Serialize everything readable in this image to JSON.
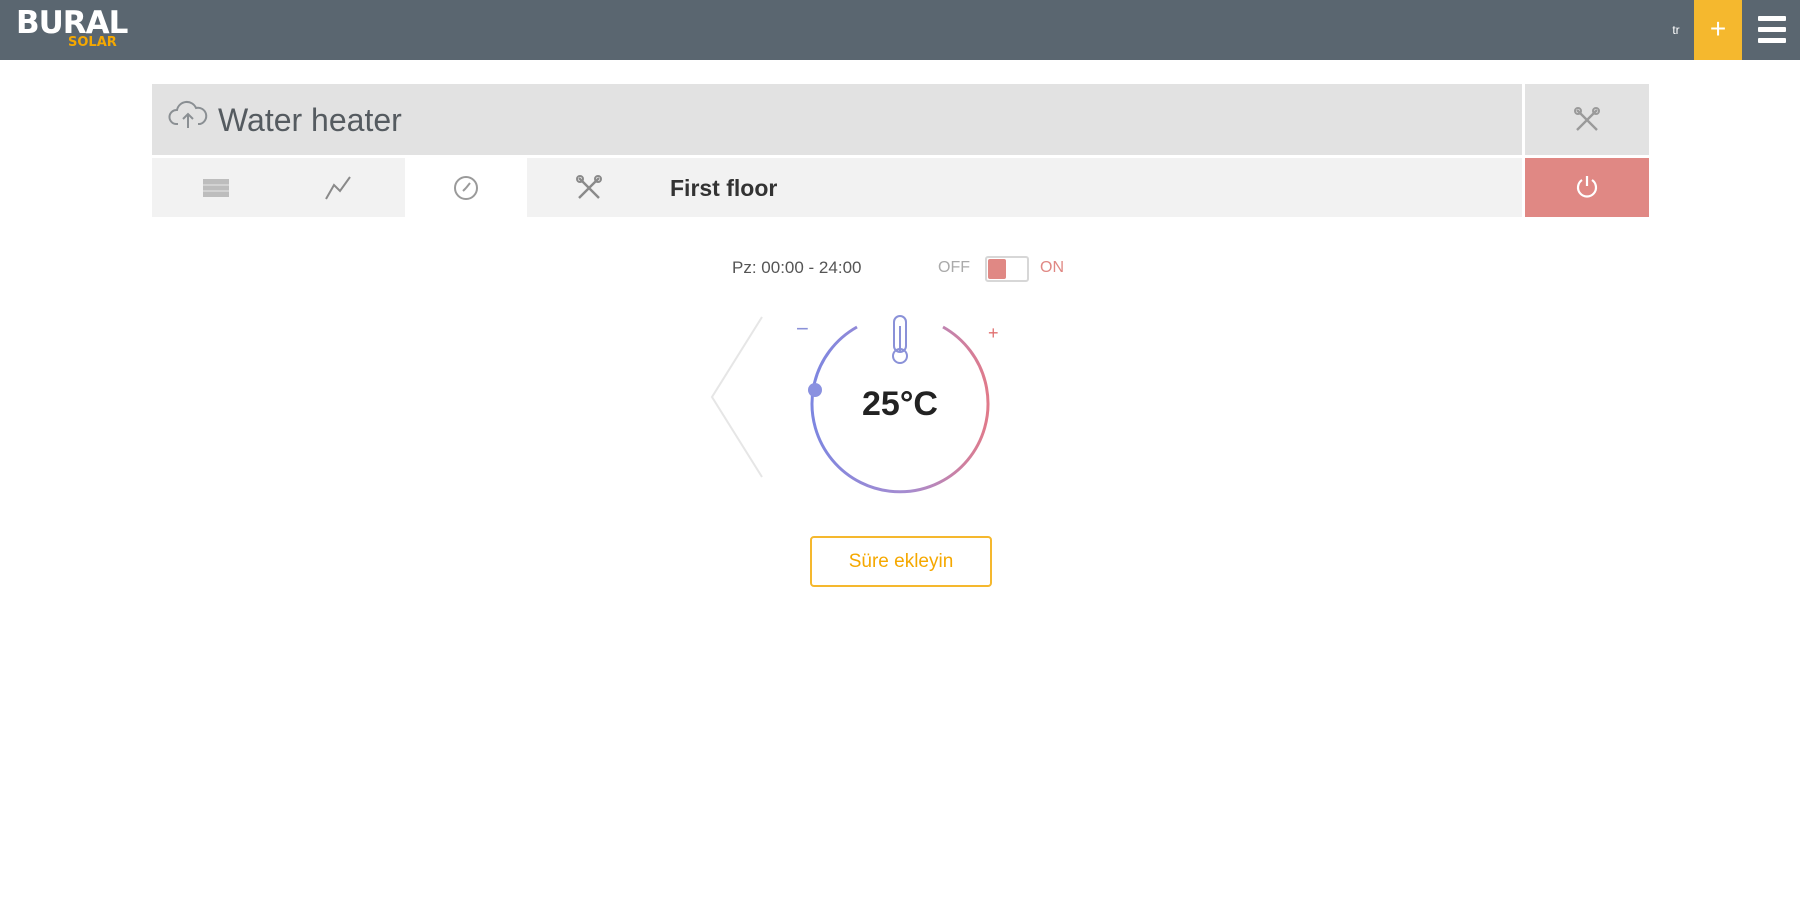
{
  "brand": {
    "name": "BURAL",
    "sub": "SOLAR",
    "accent": "#f5b82e"
  },
  "topbar": {
    "lang": "tr",
    "add_label": "+"
  },
  "device": {
    "title": "Water heater",
    "zone": "First floor",
    "tabs": [
      {
        "icon": "list-icon"
      },
      {
        "icon": "chart-icon"
      },
      {
        "icon": "clock-icon",
        "active": true
      },
      {
        "icon": "tools-icon"
      }
    ],
    "power_color": "#e08884"
  },
  "schedule": {
    "range": "Pz: 00:00 - 24:00",
    "off_label": "OFF",
    "on_label": "ON",
    "state": "off"
  },
  "thermostat": {
    "minus": "−",
    "plus": "+",
    "temperature": "25°C"
  },
  "actions": {
    "add_time": "Süre ekleyin"
  }
}
